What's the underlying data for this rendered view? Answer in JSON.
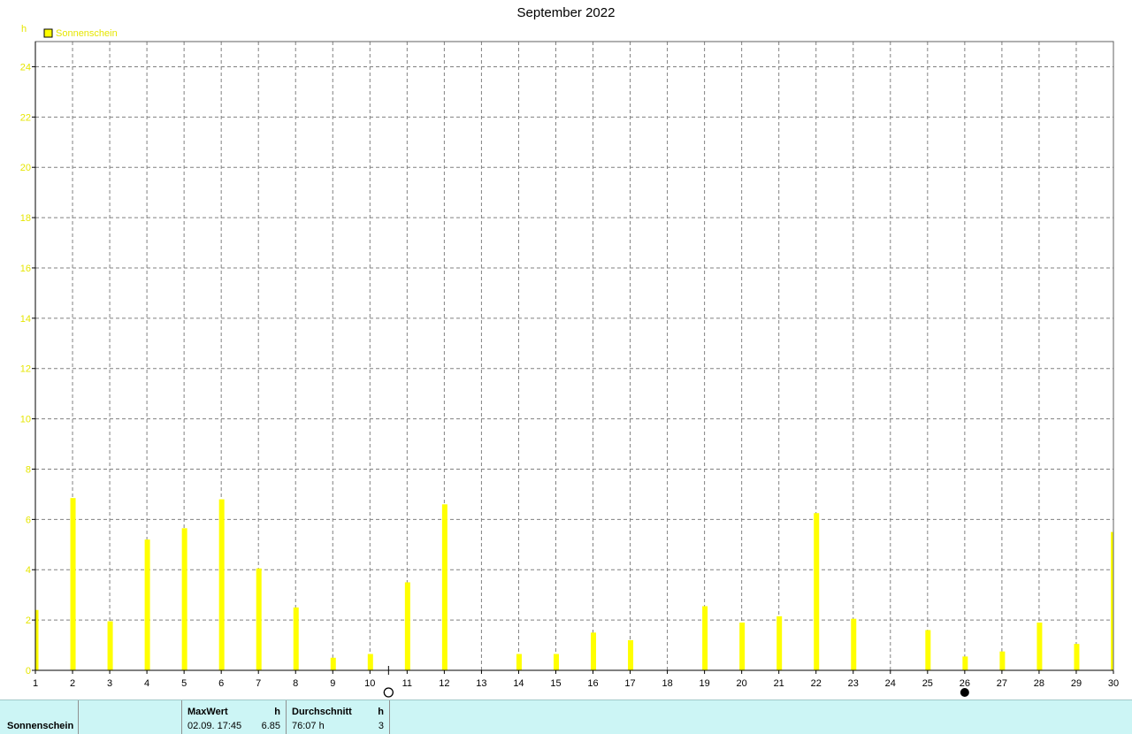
{
  "chart_data": {
    "type": "bar",
    "title": "September 2022",
    "ylabel": "h",
    "ylim": [
      0,
      25
    ],
    "yticks": [
      0,
      2,
      4,
      6,
      8,
      10,
      12,
      14,
      16,
      18,
      20,
      22,
      24
    ],
    "categories": [
      "1",
      "2",
      "3",
      "4",
      "5",
      "6",
      "7",
      "8",
      "9",
      "10",
      "11",
      "12",
      "13",
      "14",
      "15",
      "16",
      "17",
      "18",
      "19",
      "20",
      "21",
      "22",
      "23",
      "24",
      "25",
      "26",
      "27",
      "28",
      "29",
      "30"
    ],
    "series": [
      {
        "name": "Sonnenschein",
        "color": "#ffff00",
        "values": [
          2.4,
          6.85,
          1.95,
          5.2,
          5.65,
          6.8,
          4.05,
          2.5,
          0.5,
          0.65,
          3.5,
          6.6,
          0.0,
          0.65,
          0.65,
          1.5,
          1.2,
          0.0,
          2.55,
          1.9,
          2.15,
          6.25,
          2.05,
          0.0,
          1.6,
          0.55,
          0.75,
          1.9,
          1.05,
          5.5
        ]
      }
    ],
    "grid": true,
    "legend_position": "top-left",
    "markers": [
      {
        "day": 10.5,
        "symbol": "full-moon-icon"
      },
      {
        "day": 26,
        "symbol": "new-moon-icon"
      }
    ]
  },
  "info": {
    "series_label": "Sonnenschein",
    "max_header": "MaxWert",
    "max_unit": "h",
    "max_time": "02.09.  17:45",
    "max_value": "6.85",
    "avg_header": "Durchschnitt",
    "avg_unit": "h",
    "avg_total": "76:07 h",
    "avg_value": "3"
  }
}
